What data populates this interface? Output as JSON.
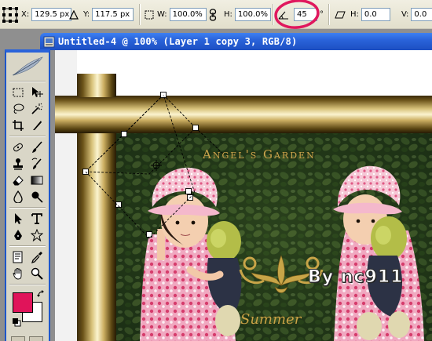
{
  "options_bar": {
    "x_label": "X:",
    "x_value": "129.5 px",
    "y_label": "Y:",
    "y_value": "117.5 px",
    "w_label": "W:",
    "w_value": "100.0%",
    "h_label": "H:",
    "h_value": "100.0%",
    "rotate_value": "45",
    "rotate_unit": "°",
    "hskew_label": "H:",
    "hskew_value": "0.0",
    "vskew_label": "V:",
    "vskew_value": "0.0",
    "vskew_unit": "°"
  },
  "document": {
    "title": "Untitled-4 @ 100% (Layer 1 copy 3, RGB/8)"
  },
  "artwork": {
    "garden_title": "Angel's Garden",
    "signature": "By nc911",
    "summer": "Summer"
  },
  "toolbox": {
    "foreground_color": "#e0145a",
    "background_color": "#ffffff"
  },
  "annotation": {
    "color": "#e0185e"
  },
  "icons": {
    "reference_point": "reference-point-icon",
    "delta": "delta-icon",
    "link": "link-icon",
    "rotate": "rotate-angle-icon",
    "skew": "skew-icon",
    "doc": "photoshop-doc-icon"
  }
}
